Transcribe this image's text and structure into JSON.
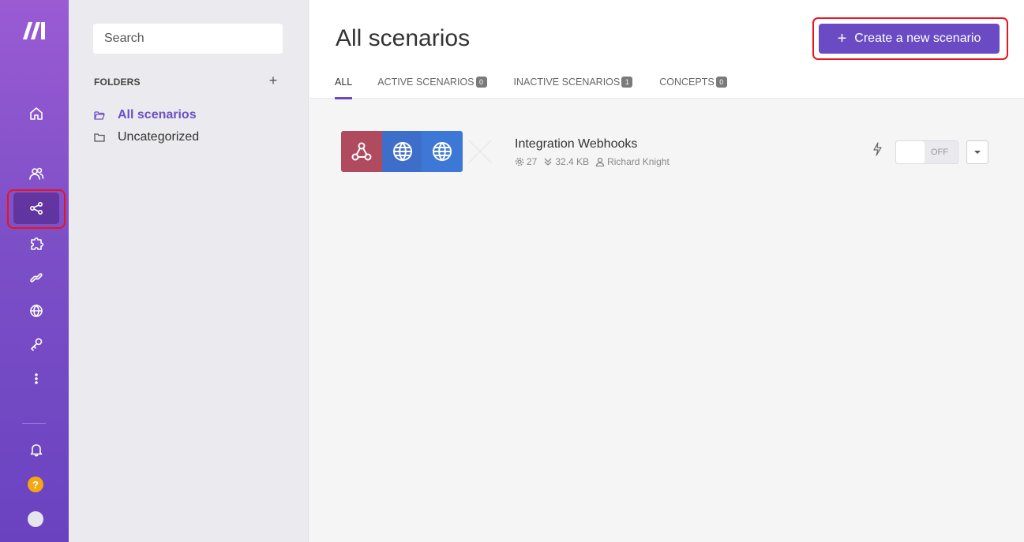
{
  "rail": {
    "items": [
      {
        "name": "home",
        "label": "Home"
      },
      {
        "name": "team",
        "label": "Team"
      },
      {
        "name": "scenarios",
        "label": "Scenarios",
        "active": true
      },
      {
        "name": "templates",
        "label": "Templates"
      },
      {
        "name": "connections",
        "label": "Connections"
      },
      {
        "name": "webhooks",
        "label": "Webhooks"
      },
      {
        "name": "keys",
        "label": "Keys"
      },
      {
        "name": "more",
        "label": "More"
      }
    ],
    "help_label": "?"
  },
  "folders": {
    "search_placeholder": "Search",
    "title": "FOLDERS",
    "add_label": "+",
    "items": [
      {
        "label": "All scenarios",
        "active": true
      },
      {
        "label": "Uncategorized",
        "active": false
      }
    ]
  },
  "main": {
    "title": "All scenarios",
    "create_button": "Create a new scenario",
    "create_plus": "+",
    "tabs": [
      {
        "label": "ALL",
        "badge": null,
        "active": true
      },
      {
        "label": "ACTIVE SCENARIOS",
        "badge": "0"
      },
      {
        "label": "INACTIVE SCENARIOS",
        "badge": "1"
      },
      {
        "label": "CONCEPTS",
        "badge": "0"
      }
    ]
  },
  "scenario": {
    "name": "Integration Webhooks",
    "operations": "27",
    "data_size": "32.4 KB",
    "owner": "Richard Knight",
    "toggle_label": "OFF",
    "modules": [
      "webhook-icon",
      "http-globe-icon",
      "http-globe-icon"
    ]
  },
  "colors": {
    "accent": "#6a4bc4",
    "highlight": "#e8141e",
    "webhook": "#b04a5f",
    "http": "#3d6ec9"
  }
}
